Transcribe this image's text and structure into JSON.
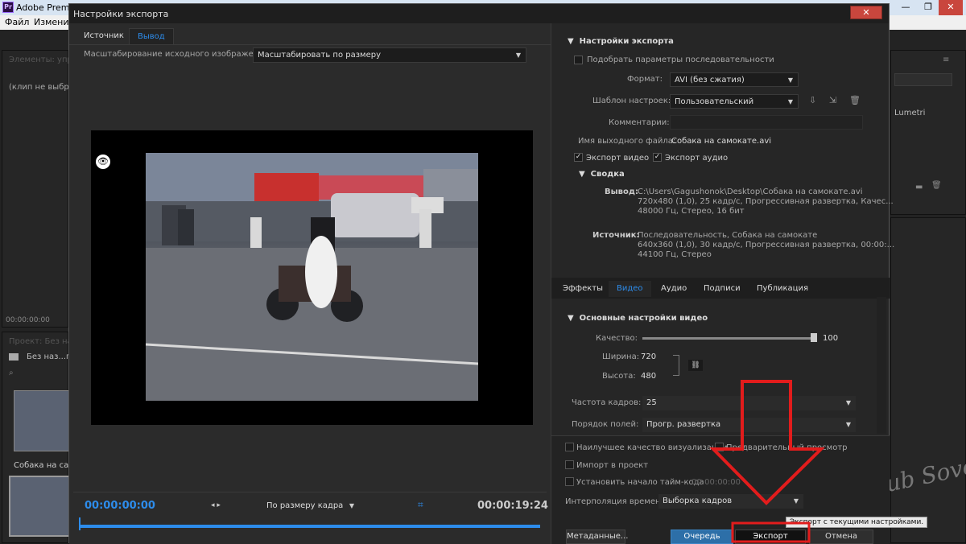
{
  "app": {
    "title": "Adobe Premiere",
    "logo": "Pr",
    "menu": [
      "Файл",
      "Измени"
    ],
    "left_panel": {
      "header": "Элементы: управ",
      "empty": "(клип не выбран)",
      "timecode": "00:00:00:00",
      "project_header": "Проект: Без на",
      "project_name": "Без наз...го",
      "clip_name": "Собака на само"
    },
    "right_panel": {
      "lumetri": "Lumetri"
    }
  },
  "dialog": {
    "title": "Настройки экспорта",
    "close": "✕",
    "tabs": [
      {
        "label": "Источник",
        "active": false
      },
      {
        "label": "Вывод",
        "active": true
      }
    ],
    "scale_label": "Масштабирование исходного изображения:",
    "scale_value": "Масштабировать по размеру",
    "watermark": "club Sovet",
    "timeline": {
      "start": "00:00:00:00",
      "end": "00:00:19:24",
      "fit": "По размеру кадра"
    },
    "export_settings": {
      "section": "Настройки экспорта",
      "match_sequence": "Подобрать параметры последовательности",
      "format_label": "Формат:",
      "format_value": "AVI (без сжатия)",
      "preset_label": "Шаблон настроек:",
      "preset_value": "Пользовательский",
      "comments_label": "Комментарии:",
      "output_label": "Имя выходного файла:",
      "output_value": "Собака на самокате.avi",
      "export_video": "Экспорт видео",
      "export_audio": "Экспорт аудио",
      "summary": "Сводка",
      "output_key": "Вывод:",
      "output_lines": [
        "C:\\Users\\Gagushonok\\Desktop\\Собака на самокате.avi",
        "720x480 (1,0), 25 кадр/с, Прогрессивная развертка, Качес...",
        "48000 Гц, Стерео, 16 бит"
      ],
      "source_key": "Источник:",
      "source_lines": [
        "Последовательность, Собака на самокате",
        "640x360 (1,0), 30 кадр/с, Прогрессивная развертка, 00:00:...",
        "44100 Гц, Стерео"
      ]
    },
    "sub_tabs": [
      {
        "label": "Эффекты",
        "active": false
      },
      {
        "label": "Видео",
        "active": true
      },
      {
        "label": "Аудио",
        "active": false
      },
      {
        "label": "Подписи",
        "active": false
      },
      {
        "label": "Публикация",
        "active": false
      }
    ],
    "video": {
      "section": "Основные настройки видео",
      "quality_label": "Качество:",
      "quality_value": "100",
      "quality_fraction": 1.0,
      "width_label": "Ширина:",
      "width_value": "720",
      "height_label": "Высота:",
      "height_value": "480",
      "fps_label": "Частота кадров:",
      "fps_value": "25",
      "field_label": "Порядок полей:",
      "field_value": "Прогр. развертка"
    },
    "options": {
      "max_render": "Наилучшее качество визуализации",
      "preview": "Предварительный просмотр",
      "import": "Импорт в проект",
      "timecode": "Установить начало тайм-кода",
      "timecode_value": "00:00:00:00",
      "interp_label": "Интерполяция времени:",
      "interp_value": "Выборка кадров"
    },
    "buttons": {
      "metadata": "Метаданные...",
      "queue": "Очередь",
      "export": "Экспорт",
      "cancel": "Отмена"
    },
    "tooltip": "Экспорт с текущими настройками."
  }
}
